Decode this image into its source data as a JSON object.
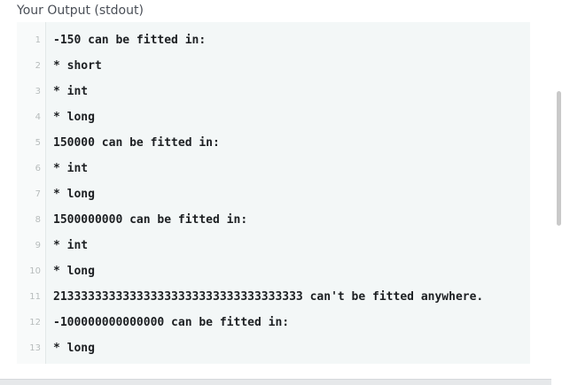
{
  "header": {
    "title": "Your Output (stdout)"
  },
  "output": {
    "lines": [
      {
        "number": "1",
        "text": "-150 can be fitted in:"
      },
      {
        "number": "2",
        "text": "* short"
      },
      {
        "number": "3",
        "text": "* int"
      },
      {
        "number": "4",
        "text": "* long"
      },
      {
        "number": "5",
        "text": "150000 can be fitted in:"
      },
      {
        "number": "6",
        "text": "* int"
      },
      {
        "number": "7",
        "text": "* long"
      },
      {
        "number": "8",
        "text": "1500000000 can be fitted in:"
      },
      {
        "number": "9",
        "text": "* int"
      },
      {
        "number": "10",
        "text": "* long"
      },
      {
        "number": "11",
        "text": "213333333333333333333333333333333333 can't be fitted anywhere."
      },
      {
        "number": "12",
        "text": "-100000000000000 can be fitted in:"
      },
      {
        "number": "13",
        "text": "* long"
      }
    ]
  }
}
